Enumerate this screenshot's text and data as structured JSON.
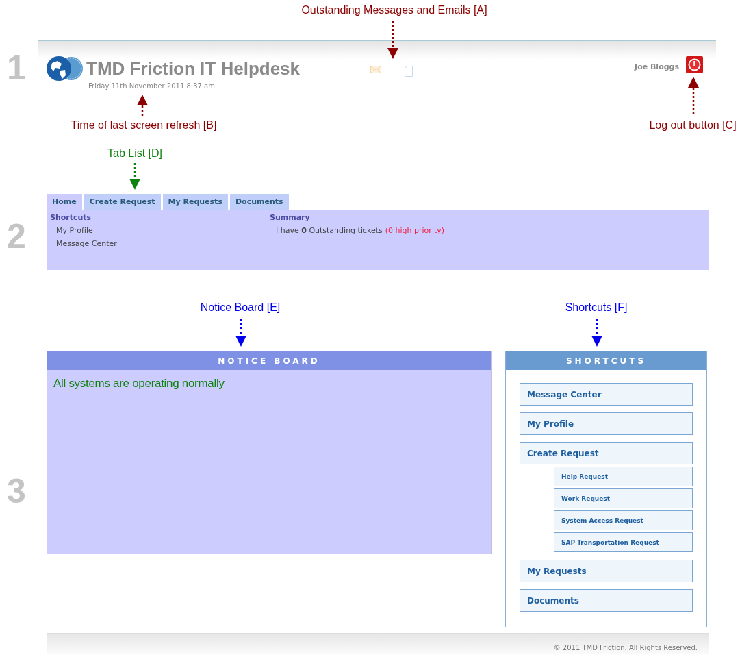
{
  "annotations": [
    {
      "text": "Outstanding Messages and Emails [A]",
      "color": "#8b0000"
    },
    {
      "text": "Time of last screen refresh [B]",
      "color": "#8b0000"
    },
    {
      "text": "Log out button [C]",
      "color": "#8b0000"
    },
    {
      "text": "Tab List [D]",
      "color": "#108010"
    },
    {
      "text": "Notice Board [E]",
      "color": "#0000ee"
    },
    {
      "text": "Shortcuts [F]",
      "color": "#0000ee"
    }
  ],
  "section_numbers": [
    "1",
    "2",
    "3"
  ],
  "header": {
    "title": "TMD Friction IT Helpdesk",
    "date": "Friday 11th November 2011 8:37 am",
    "user": "Joe Bloggs"
  },
  "tabs": [
    {
      "label": "Home",
      "selected": true
    },
    {
      "label": "Create Request",
      "selected": false
    },
    {
      "label": "My Requests",
      "selected": false
    },
    {
      "label": "Documents",
      "selected": false
    }
  ],
  "home_panel": {
    "shortcuts": {
      "heading": "Shortcuts",
      "items": [
        "My Profile",
        "Message Center"
      ]
    },
    "summary": {
      "heading": "Summary",
      "text": "I have **0** Outstanding tickets",
      "priority": "(0 high priority)"
    }
  },
  "notice_board": {
    "title": "NOTICE BOARD",
    "message": "All systems are operating normally"
  },
  "shortcuts": {
    "title": "SHORTCUTS",
    "items": [
      {
        "label": "Message Center"
      },
      {
        "label": "My Profile"
      },
      {
        "label": "Create Request",
        "children": [
          {
            "label": "Help Request"
          },
          {
            "label": "Work Request"
          },
          {
            "label": "System Access Request"
          },
          {
            "label": "SAP Transportation Request"
          }
        ]
      },
      {
        "label": "My Requests"
      },
      {
        "label": "Documents"
      }
    ]
  },
  "footer": "© 2011 TMD Friction. All Rights Reserved."
}
